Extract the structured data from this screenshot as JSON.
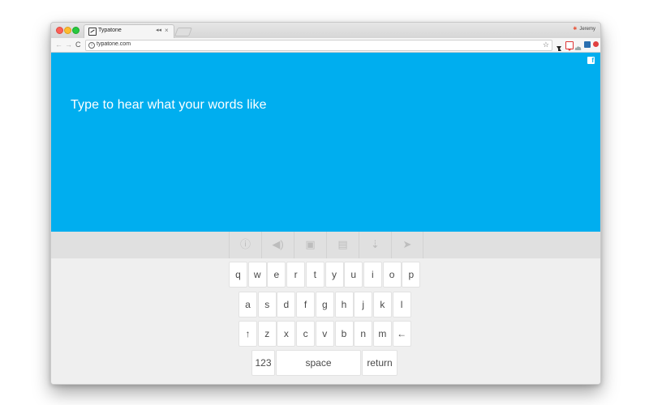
{
  "browser": {
    "tab_title": "Typatone",
    "tab_audio": "◂◂",
    "tab_close": "×",
    "profile_name": "Jeremy",
    "url": "typatone.com",
    "nav_back": "←",
    "nav_forward": "→",
    "nav_reload": "C",
    "star": "☆"
  },
  "hero": {
    "headline": "Type to hear what your words like",
    "background": "#00aeef",
    "facebook_label": "f"
  },
  "actions": [
    {
      "icon": "info-icon",
      "glyph": "ⓘ"
    },
    {
      "icon": "volume-icon",
      "glyph": "◀)"
    },
    {
      "icon": "save-icon",
      "glyph": "▣"
    },
    {
      "icon": "clipboard-icon",
      "glyph": "▤"
    },
    {
      "icon": "download-icon",
      "glyph": "⇣"
    },
    {
      "icon": "send-icon",
      "glyph": "➤"
    }
  ],
  "keyboard": {
    "row1": [
      "q",
      "w",
      "e",
      "r",
      "t",
      "y",
      "u",
      "i",
      "o",
      "p"
    ],
    "row2": [
      "a",
      "s",
      "d",
      "f",
      "g",
      "h",
      "j",
      "k",
      "l"
    ],
    "row3": [
      "↑",
      "z",
      "x",
      "c",
      "v",
      "b",
      "n",
      "m",
      "←"
    ],
    "numbers": "123",
    "space": "space",
    "return": "return"
  }
}
